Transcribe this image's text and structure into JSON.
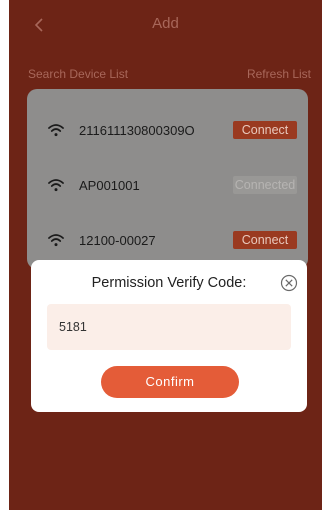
{
  "header": {
    "title": "Add",
    "back_icon": "chevron-left-icon"
  },
  "list_header": {
    "search_label": "Search Device List",
    "refresh_label": "Refresh List"
  },
  "devices": [
    {
      "name": "211611130800309O",
      "action": "Connect",
      "state": "connect",
      "icon": "wifi-icon"
    },
    {
      "name": "AP001001",
      "action": "Connected",
      "state": "connected",
      "icon": "wifi-icon"
    },
    {
      "name": "12100-00027",
      "action": "Connect",
      "state": "connect",
      "icon": "wifi-icon"
    }
  ],
  "dialog": {
    "title": "Permission Verify Code:",
    "code_value": "5181",
    "confirm_label": "Confirm",
    "close_icon": "close-circle-icon"
  },
  "colors": {
    "background": "#6d2416",
    "accent": "#e45c38",
    "input_bg": "#fbeee8"
  }
}
